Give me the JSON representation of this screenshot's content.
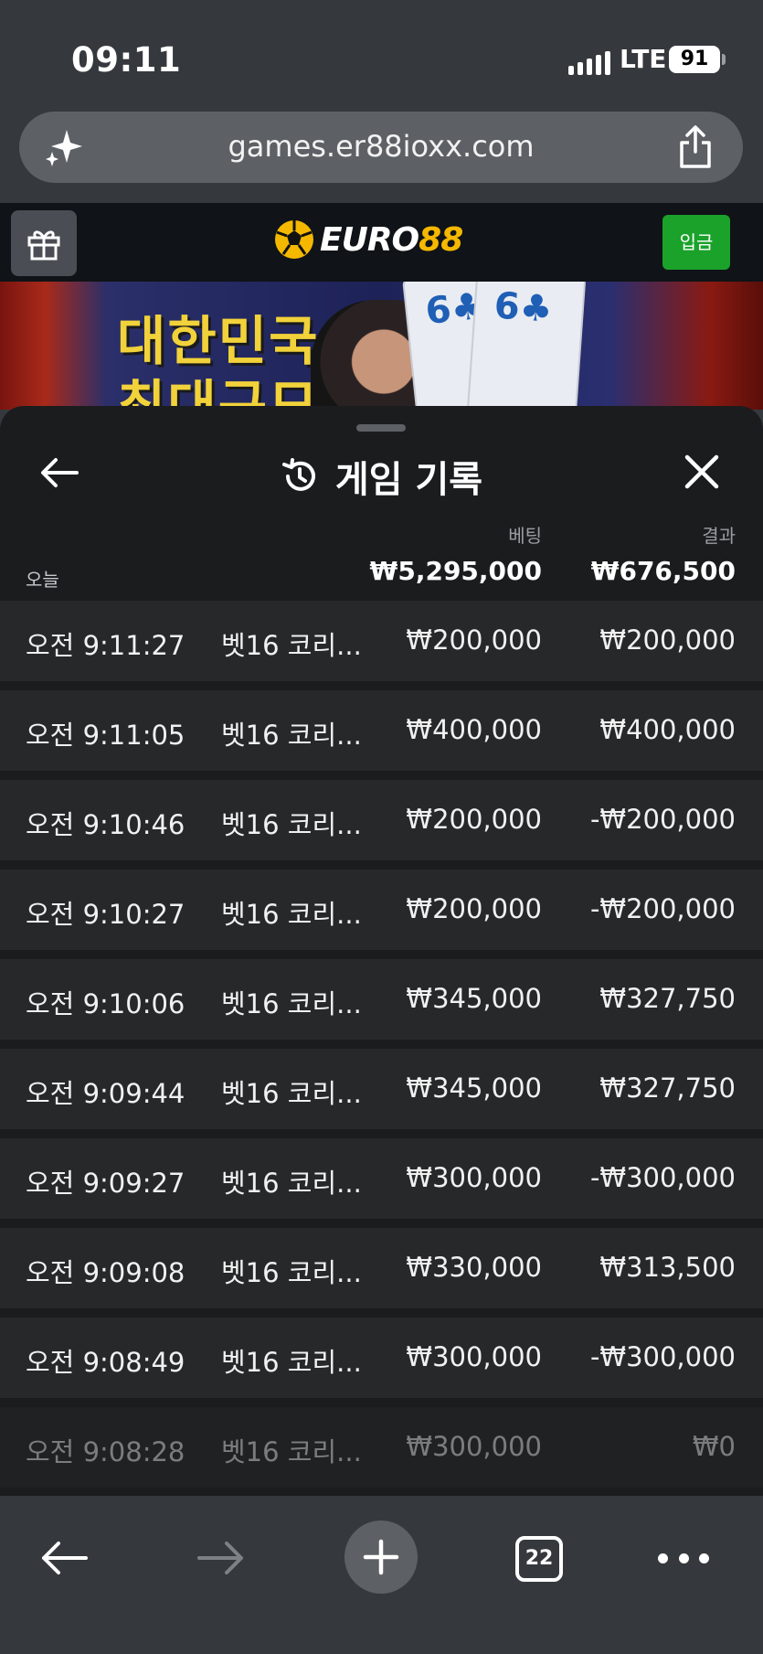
{
  "status_bar": {
    "time": "09:11",
    "network": "LTE",
    "battery": "91"
  },
  "browser": {
    "url": "games.er88ioxx.com",
    "tab_count": "22"
  },
  "site": {
    "logo_prefix": "EURO",
    "logo_suffix": "88",
    "deposit_label": "입금"
  },
  "banner": {
    "line1": "대한민국",
    "line2": "최대규모",
    "card_value": "6"
  },
  "sheet": {
    "title": "게임 기록",
    "bet_header": "베팅",
    "result_header": "결과",
    "today_label": "오늘",
    "total_bet": "₩5,295,000",
    "total_result": "₩676,500"
  },
  "records": [
    {
      "time": "오전 9:11:27",
      "game": "벳16 코리...",
      "bet": "₩200,000",
      "result": "₩200,000"
    },
    {
      "time": "오전 9:11:05",
      "game": "벳16 코리...",
      "bet": "₩400,000",
      "result": "₩400,000"
    },
    {
      "time": "오전 9:10:46",
      "game": "벳16 코리...",
      "bet": "₩200,000",
      "result": "-₩200,000"
    },
    {
      "time": "오전 9:10:27",
      "game": "벳16 코리...",
      "bet": "₩200,000",
      "result": "-₩200,000"
    },
    {
      "time": "오전 9:10:06",
      "game": "벳16 코리...",
      "bet": "₩345,000",
      "result": "₩327,750"
    },
    {
      "time": "오전 9:09:44",
      "game": "벳16 코리...",
      "bet": "₩345,000",
      "result": "₩327,750"
    },
    {
      "time": "오전 9:09:27",
      "game": "벳16 코리...",
      "bet": "₩300,000",
      "result": "-₩300,000"
    },
    {
      "time": "오전 9:09:08",
      "game": "벳16 코리...",
      "bet": "₩330,000",
      "result": "₩313,500"
    },
    {
      "time": "오전 9:08:49",
      "game": "벳16 코리...",
      "bet": "₩300,000",
      "result": "-₩300,000"
    },
    {
      "time": "오전 9:08:28",
      "game": "벳16 코리...",
      "bet": "₩300,000",
      "result": "₩0"
    }
  ],
  "colors": {
    "deposit": "#1aa22a",
    "logo_accent": "#f5b800",
    "sheet_bg": "#1b1c1e",
    "row_bg": "#27282a"
  }
}
